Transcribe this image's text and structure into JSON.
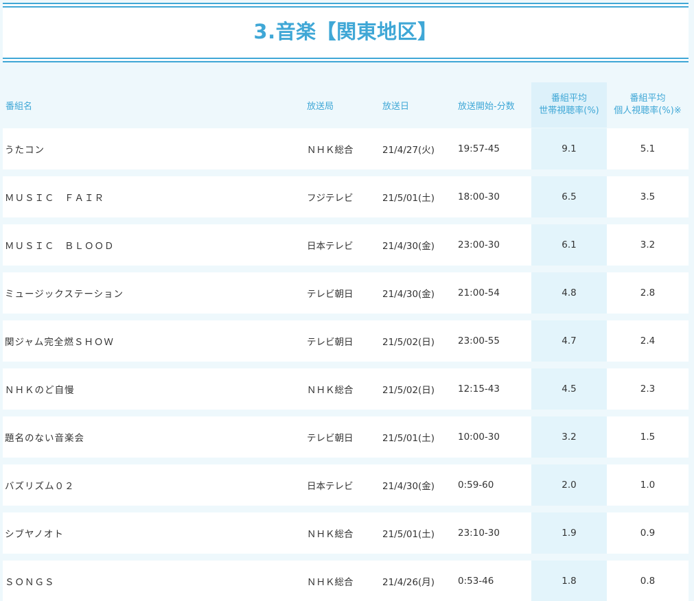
{
  "title": "3.音楽【関東地区】",
  "headers": {
    "program": "番組名",
    "station": "放送局",
    "date": "放送日",
    "start": "放送開始-分数",
    "household_line1": "番組平均",
    "household_line2": "世帯視聴率(%)",
    "personal_line1": "番組平均",
    "personal_line2": "個人視聴率(%)※"
  },
  "rows": [
    {
      "program": "うたコン",
      "station": "ＮＨＫ総合",
      "date": "21/4/27(火)",
      "start": "19:57-45",
      "household": "9.1",
      "personal": "5.1"
    },
    {
      "program": "ＭＵＳＩＣ　ＦＡＩＲ",
      "station": "フジテレビ",
      "date": "21/5/01(土)",
      "start": "18:00-30",
      "household": "6.5",
      "personal": "3.5"
    },
    {
      "program": "ＭＵＳＩＣ　ＢＬＯＯＤ",
      "station": "日本テレビ",
      "date": "21/4/30(金)",
      "start": "23:00-30",
      "household": "6.1",
      "personal": "3.2"
    },
    {
      "program": "ミュージックステーション",
      "station": "テレビ朝日",
      "date": "21/4/30(金)",
      "start": "21:00-54",
      "household": "4.8",
      "personal": "2.8"
    },
    {
      "program": "関ジャム完全燃ＳＨＯＷ",
      "station": "テレビ朝日",
      "date": "21/5/02(日)",
      "start": "23:00-55",
      "household": "4.7",
      "personal": "2.4"
    },
    {
      "program": "ＮＨＫのど自慢",
      "station": "ＮＨＫ総合",
      "date": "21/5/02(日)",
      "start": "12:15-43",
      "household": "4.5",
      "personal": "2.3"
    },
    {
      "program": "題名のない音楽会",
      "station": "テレビ朝日",
      "date": "21/5/01(土)",
      "start": "10:00-30",
      "household": "3.2",
      "personal": "1.5"
    },
    {
      "program": "バズリズム０２",
      "station": "日本テレビ",
      "date": "21/4/30(金)",
      "start": "0:59-60",
      "household": "2.0",
      "personal": "1.0"
    },
    {
      "program": "シブヤノオト",
      "station": "ＮＨＫ総合",
      "date": "21/5/01(土)",
      "start": "23:10-30",
      "household": "1.9",
      "personal": "0.9"
    },
    {
      "program": "ＳＯＮＧＳ",
      "station": "ＮＨＫ総合",
      "date": "21/4/26(月)",
      "start": "0:53-46",
      "household": "1.8",
      "personal": "0.8"
    }
  ]
}
